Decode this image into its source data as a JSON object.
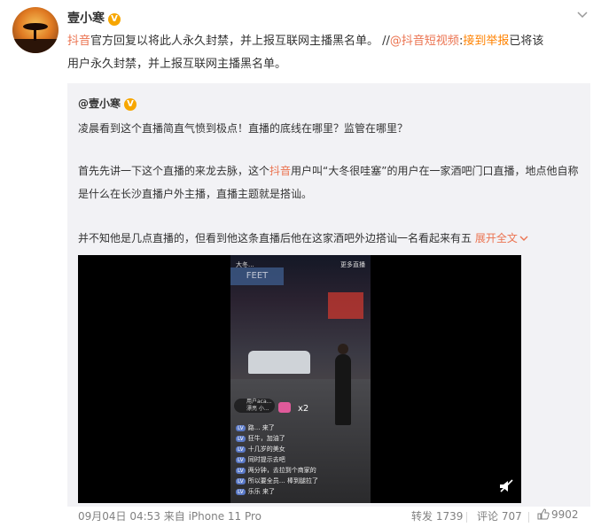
{
  "post": {
    "author": "壹小寒",
    "verified_badge": "V",
    "text_line1_part1": "抖音",
    "text_line1_part2": "官方回复以将此人永久封禁，并上报互联网主播黑名单。 //",
    "mention": "@抖音短视频",
    "colon": ":",
    "report_text": "接到举报",
    "text_line1_part3": "已将该",
    "text_line2": "用户永久封禁，并上报互联网主播黑名单。"
  },
  "quote": {
    "author": "@壹小寒",
    "verified_badge": "V",
    "para1": "凌晨看到这个直播简直气愤到极点！直播的底线在哪里？监管在哪里？",
    "para2_part1": "首先先讲一下这个直播的来龙去脉，这个",
    "para2_hl": "抖音",
    "para2_part2": "用户叫“大冬很哇塞”的用户在一家酒吧门口直播，地点他自称",
    "para2_line2": "是什么在长沙直播户外主播，直播主题就是搭讪。",
    "para3": "并不知他是几点直播的，但看到他这条直播后他在这家酒吧外边搭讪一名看起来有五",
    "expand": "展开全文",
    "video": {
      "top_left": "大冬...",
      "top_right": "更多直播",
      "sign": "FEET",
      "user_chip": "用户aca... 漂亮 小...",
      "count": "x2",
      "comments": [
        {
          "tag": "LV",
          "text": "路... 来了"
        },
        {
          "tag": "LV",
          "text": "狂牛，加油了"
        },
        {
          "tag": "LV",
          "text": "十几岁的美女"
        },
        {
          "tag": "LV",
          "text": "同时提示去吧"
        },
        {
          "tag": "LV",
          "text": "两分钟，去拉到个商家的"
        },
        {
          "tag": "LV",
          "text": "所以要全员…  棒到腿拉了"
        },
        {
          "tag": "LV",
          "text": "乐乐 来了"
        }
      ]
    }
  },
  "footer": {
    "date": "09月04日 04:53 来自 iPhone 11 Pro",
    "repost": "转发 1739",
    "comment": "评论 707",
    "likes": "9902"
  }
}
